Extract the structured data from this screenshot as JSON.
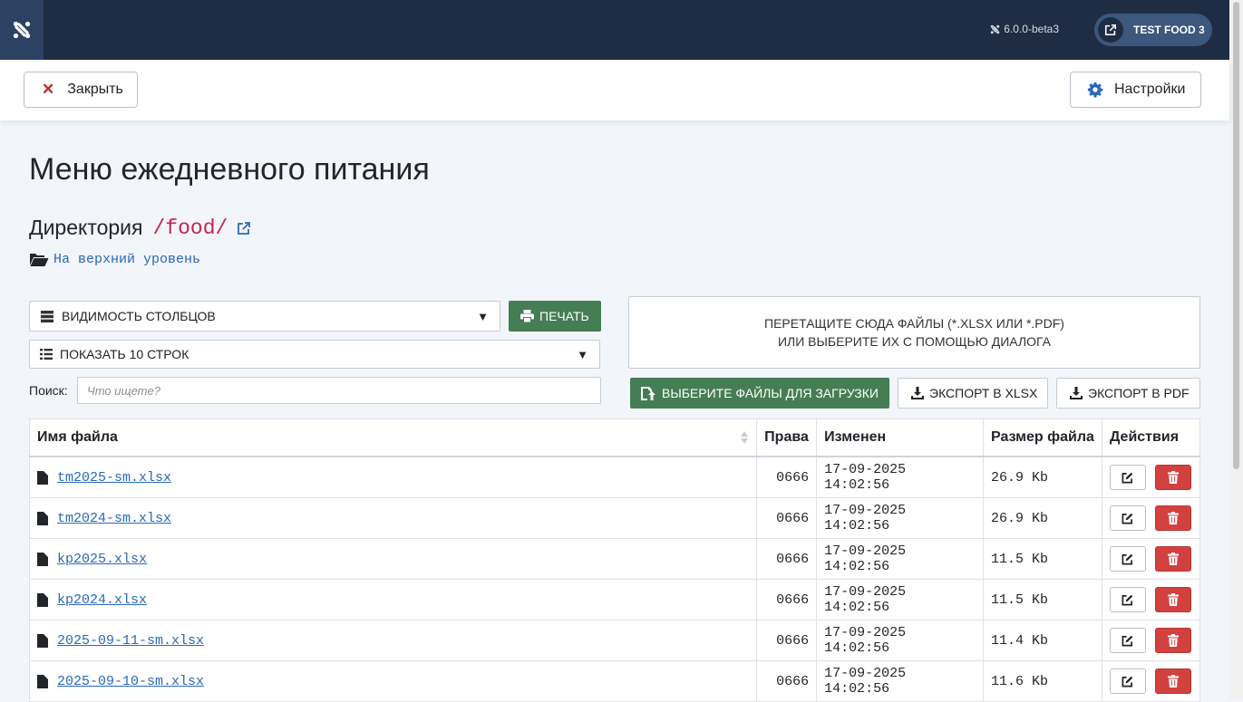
{
  "header": {
    "version": "6.0.0-beta3",
    "site_label": "TEST FOOD 3"
  },
  "toolbar": {
    "close_label": "Закрыть",
    "options_label": "Настройки"
  },
  "page": {
    "title": "Меню ежедневного питания",
    "directory_label": "Директория",
    "directory_path": "/food/",
    "up_label": "На верхний уровень"
  },
  "controls": {
    "columns_visibility": "ВИДИМОСТЬ СТОЛБЦОВ",
    "print_label": "ПЕЧАТЬ",
    "show_rows": "ПОКАЗАТЬ 10 СТРОК",
    "search_label": "Поиск:",
    "search_placeholder": "Что ищете?",
    "dropzone_line1": "ПЕРЕТАЩИТЕ СЮДА ФАЙЛЫ (*.XLSX ИЛИ *.PDF)",
    "dropzone_line2": "ИЛИ ВЫБЕРИТЕ ИХ С ПОМОЩЬЮ ДИАЛОГА",
    "upload_label": "ВЫБЕРИТЕ ФАЙЛЫ ДЛЯ ЗАГРУЗКИ",
    "export_xlsx": "ЭКСПОРТ В XLSX",
    "export_pdf": "ЭКСПОРТ В PDF"
  },
  "table": {
    "columns": [
      "Имя файла",
      "Права",
      "Изменен",
      "Размер файла",
      "Действия"
    ],
    "rows": [
      {
        "name": "tm2025-sm.xlsx",
        "perm": "0666",
        "modified": "17-09-2025 14:02:56",
        "size": "26.9 Kb"
      },
      {
        "name": "tm2024-sm.xlsx",
        "perm": "0666",
        "modified": "17-09-2025 14:02:56",
        "size": "26.9 Kb"
      },
      {
        "name": "kp2025.xlsx",
        "perm": "0666",
        "modified": "17-09-2025 14:02:56",
        "size": "11.5 Kb"
      },
      {
        "name": "kp2024.xlsx",
        "perm": "0666",
        "modified": "17-09-2025 14:02:56",
        "size": "11.5 Kb"
      },
      {
        "name": "2025-09-11-sm.xlsx",
        "perm": "0666",
        "modified": "17-09-2025 14:02:56",
        "size": "11.4 Kb"
      },
      {
        "name": "2025-09-10-sm.xlsx",
        "perm": "0666",
        "modified": "17-09-2025 14:02:56",
        "size": "11.6 Kb"
      }
    ]
  },
  "colors": {
    "header_bg": "#1f2d44",
    "success": "#457d54",
    "danger": "#d2413f",
    "link": "#2a69b8"
  }
}
